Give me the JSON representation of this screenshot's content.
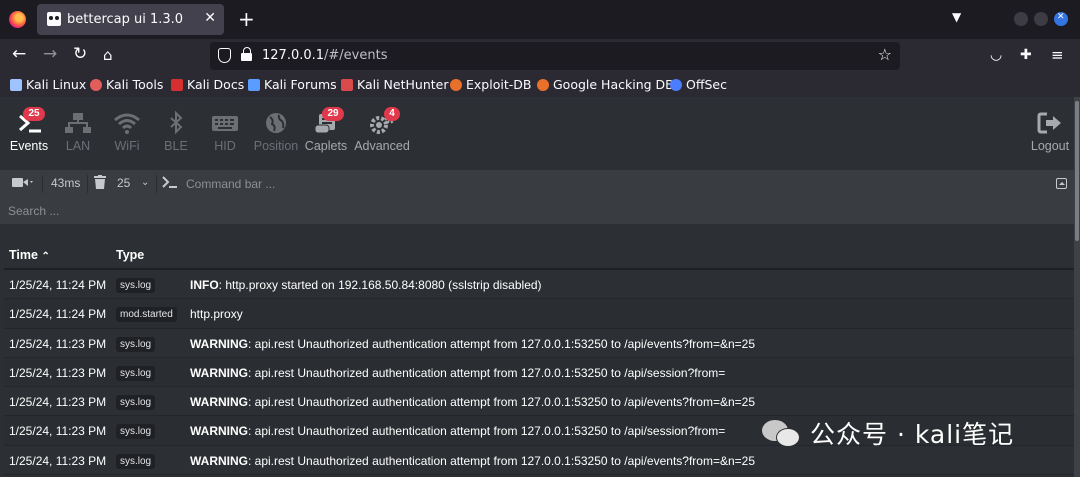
{
  "browser": {
    "tab": {
      "title": "bettercap ui 1.3.0",
      "close": "✕"
    },
    "new_tab": "+",
    "url": {
      "host": "127.0.0.1",
      "path": "/#/events"
    },
    "bookmarks": [
      {
        "label": "Kali Linux",
        "color": "#9ec3ff"
      },
      {
        "label": "Kali Tools",
        "color": "#e35d5d"
      },
      {
        "label": "Kali Docs",
        "color": "#d62f2f"
      },
      {
        "label": "Kali Forums",
        "color": "#5a9cff"
      },
      {
        "label": "Kali NetHunter",
        "color": "#d94a4a"
      },
      {
        "label": "Exploit-DB",
        "color": "#e8702a"
      },
      {
        "label": "Google Hacking DB",
        "color": "#e8702a"
      },
      {
        "label": "OffSec",
        "color": "#4a7dff"
      }
    ]
  },
  "app": {
    "nav": [
      {
        "label": "Events",
        "badge": "25",
        "state": "active",
        "icon": "terminal-icon"
      },
      {
        "label": "LAN",
        "badge": "",
        "state": "disabled",
        "icon": "network-icon"
      },
      {
        "label": "WiFi",
        "badge": "",
        "state": "disabled",
        "icon": "wifi-icon"
      },
      {
        "label": "BLE",
        "badge": "",
        "state": "disabled",
        "icon": "bluetooth-icon"
      },
      {
        "label": "HID",
        "badge": "",
        "state": "disabled",
        "icon": "keyboard-icon"
      },
      {
        "label": "Position",
        "badge": "",
        "state": "disabled",
        "icon": "globe-icon"
      },
      {
        "label": "Caplets",
        "badge": "29",
        "state": "enabled",
        "icon": "scroll-icon"
      },
      {
        "label": "Advanced",
        "badge": "4",
        "state": "enabled",
        "icon": "cogs-icon"
      }
    ],
    "logout_label": "Logout",
    "toolbar": {
      "latency": "43ms",
      "page_size": "25",
      "command_placeholder": "Command bar ...",
      "search_placeholder": "Search ..."
    },
    "table": {
      "headers": {
        "time": "Time",
        "type": "Type"
      },
      "rows": [
        {
          "time": "1/25/24, 11:24 PM",
          "type": "sys.log",
          "level": "INFO",
          "message": ": http.proxy started on 192.168.50.84:8080 (sslstrip disabled)"
        },
        {
          "time": "1/25/24, 11:24 PM",
          "type": "mod.started",
          "level": "",
          "message": "http.proxy"
        },
        {
          "time": "1/25/24, 11:23 PM",
          "type": "sys.log",
          "level": "WARNING",
          "message": ": api.rest Unauthorized authentication attempt from 127.0.0.1:53250 to /api/events?from=&n=25"
        },
        {
          "time": "1/25/24, 11:23 PM",
          "type": "sys.log",
          "level": "WARNING",
          "message": ": api.rest Unauthorized authentication attempt from 127.0.0.1:53250 to /api/session?from="
        },
        {
          "time": "1/25/24, 11:23 PM",
          "type": "sys.log",
          "level": "WARNING",
          "message": ": api.rest Unauthorized authentication attempt from 127.0.0.1:53250 to /api/events?from=&n=25"
        },
        {
          "time": "1/25/24, 11:23 PM",
          "type": "sys.log",
          "level": "WARNING",
          "message": ": api.rest Unauthorized authentication attempt from 127.0.0.1:53250 to /api/session?from="
        },
        {
          "time": "1/25/24, 11:23 PM",
          "type": "sys.log",
          "level": "WARNING",
          "message": ": api.rest Unauthorized authentication attempt from 127.0.0.1:53250 to /api/events?from=&n=25"
        }
      ]
    }
  },
  "watermark": {
    "text": "公众号 · kali笔记"
  }
}
